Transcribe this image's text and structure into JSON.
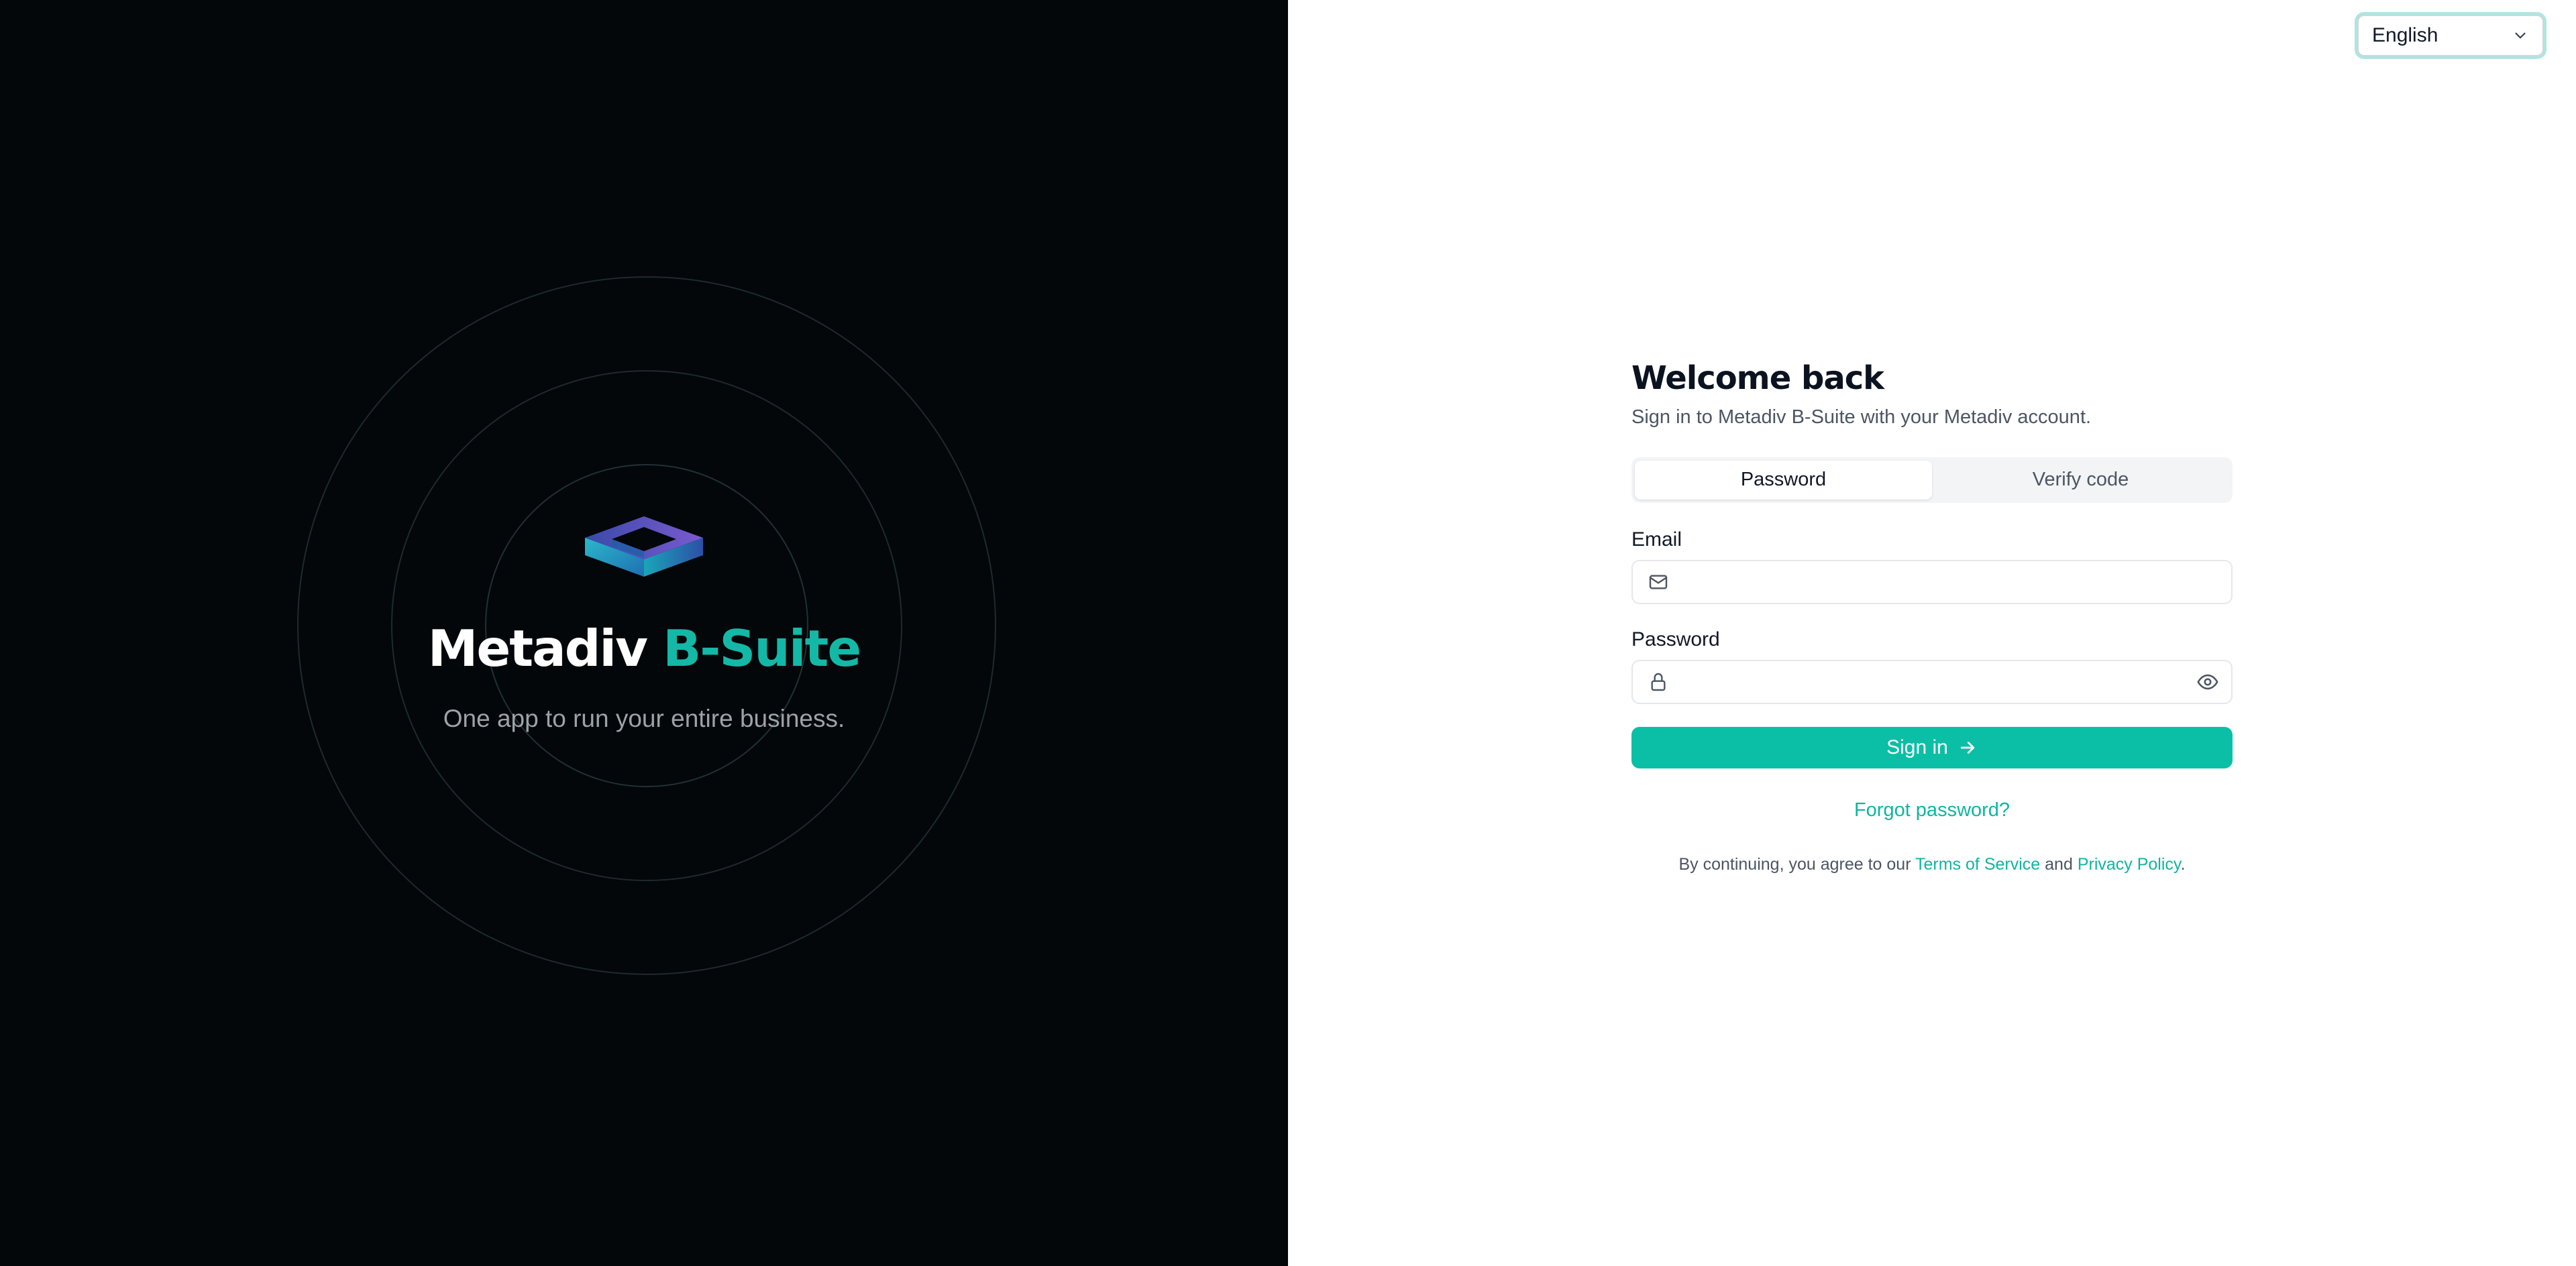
{
  "brand": {
    "name_part1": "Metadiv",
    "name_part2": "B-Suite",
    "tagline": "One app to run your entire business.",
    "logo_icon": "metadiv-cube-logo"
  },
  "language": {
    "selected": "English",
    "icon": "chevron-down-icon"
  },
  "form": {
    "title": "Welcome back",
    "subtitle": "Sign in to Metadiv B-Suite with your Metadiv account.",
    "tabs": [
      {
        "label": "Password",
        "active": true
      },
      {
        "label": "Verify code",
        "active": false
      }
    ],
    "email": {
      "label": "Email",
      "value": "",
      "icon": "mail-icon"
    },
    "password": {
      "label": "Password",
      "value": "",
      "icon": "lock-icon",
      "toggle_icon": "eye-icon"
    },
    "submit_label": "Sign in",
    "submit_icon": "arrow-right-icon",
    "forgot_label": "Forgot password?",
    "legal": {
      "prefix": "By continuing, you agree to our",
      "terms": "Terms of Service",
      "and": "and",
      "privacy": "Privacy Policy",
      "suffix": "."
    }
  },
  "colors": {
    "accent": "#14b8a6",
    "left_panel_bg": "#030709",
    "button_bg": "#0bbfa6"
  }
}
